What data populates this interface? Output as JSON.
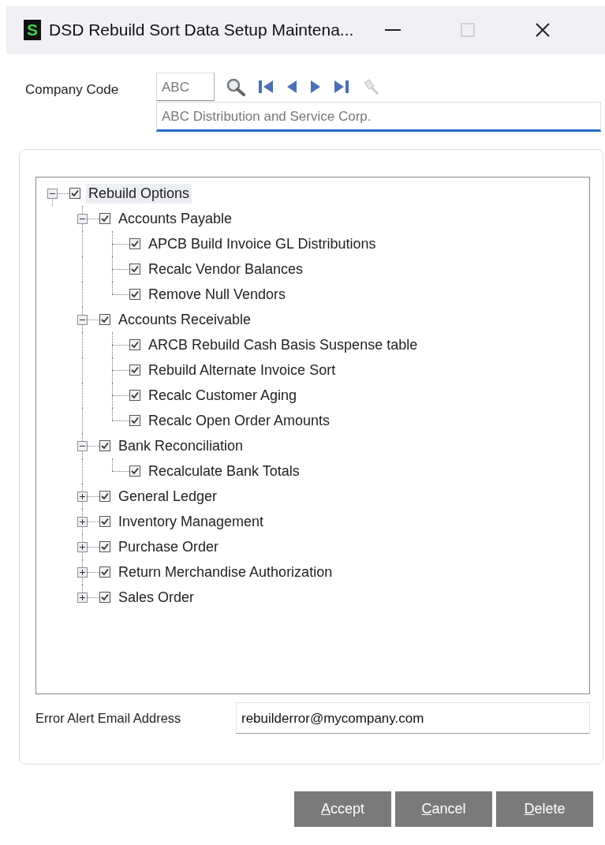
{
  "window": {
    "logo": "S",
    "title": "DSD Rebuild Sort Data Setup Maintena...",
    "maximize_disabled": true
  },
  "company": {
    "label": "Company Code",
    "code": "ABC",
    "description": "ABC Distribution and Service Corp."
  },
  "tree": [
    {
      "label": "Rebuild Options",
      "checked": true,
      "expanded": true,
      "selected": true,
      "children": [
        {
          "label": "Accounts Payable",
          "checked": true,
          "expanded": true,
          "selected": false,
          "children": [
            {
              "label": "APCB Build Invoice GL Distributions",
              "checked": true,
              "selected": false
            },
            {
              "label": "Recalc Vendor Balances",
              "checked": true,
              "selected": false
            },
            {
              "label": "Remove Null Vendors",
              "checked": true,
              "selected": false
            }
          ]
        },
        {
          "label": "Accounts Receivable",
          "checked": true,
          "expanded": true,
          "selected": false,
          "children": [
            {
              "label": "ARCB Rebuild Cash Basis Suspense table",
              "checked": true,
              "selected": false
            },
            {
              "label": "Rebuild Alternate Invoice Sort",
              "checked": true,
              "selected": false
            },
            {
              "label": "Recalc Customer Aging",
              "checked": true,
              "selected": false
            },
            {
              "label": "Recalc Open Order Amounts",
              "checked": true,
              "selected": false
            }
          ]
        },
        {
          "label": "Bank Reconciliation",
          "checked": true,
          "expanded": true,
          "selected": false,
          "children": [
            {
              "label": "Recalculate Bank Totals",
              "checked": true,
              "selected": false
            }
          ]
        },
        {
          "label": "General Ledger",
          "checked": true,
          "expanded": false,
          "selected": false
        },
        {
          "label": "Inventory Management",
          "checked": true,
          "expanded": false,
          "selected": false
        },
        {
          "label": "Purchase Order",
          "checked": true,
          "expanded": false,
          "selected": false
        },
        {
          "label": "Return Merchandise Authorization",
          "checked": true,
          "expanded": false,
          "selected": false
        },
        {
          "label": "Sales Order",
          "checked": true,
          "expanded": false,
          "selected": false
        }
      ]
    }
  ],
  "email": {
    "label": "Error Alert Email Address",
    "value": "rebuilderror@mycompany.com"
  },
  "buttons": [
    {
      "label": "Accept"
    },
    {
      "label": "Cancel"
    },
    {
      "label": "Delete"
    }
  ]
}
